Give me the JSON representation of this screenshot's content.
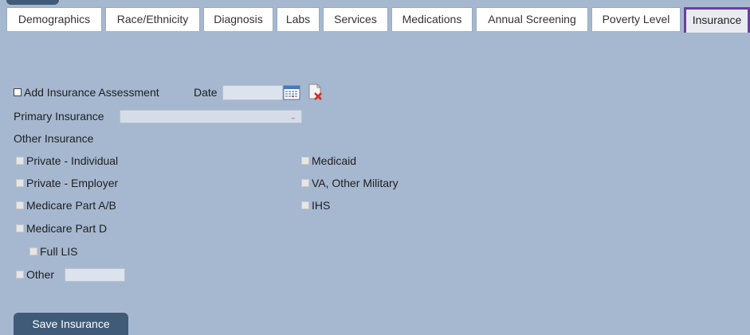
{
  "tabs": [
    {
      "label": "Demographics",
      "active": false
    },
    {
      "label": "Race/Ethnicity",
      "active": false
    },
    {
      "label": "Diagnosis",
      "active": false
    },
    {
      "label": "Labs",
      "active": false
    },
    {
      "label": "Services",
      "active": false
    },
    {
      "label": "Medications",
      "active": false
    },
    {
      "label": "Annual Screening",
      "active": false
    },
    {
      "label": "Poverty Level",
      "active": false
    },
    {
      "label": "Insurance",
      "active": true
    }
  ],
  "form": {
    "add_assessment_label": "Add Insurance Assessment",
    "add_assessment_checked": false,
    "date_label": "Date",
    "date_value": "",
    "primary_insurance_label": "Primary Insurance",
    "primary_insurance_value": "",
    "other_insurance_label": "Other Insurance",
    "options_left": [
      {
        "label": "Private - Individual",
        "checked": false
      },
      {
        "label": "Private - Employer",
        "checked": false
      },
      {
        "label": "Medicare Part A/B",
        "checked": false
      },
      {
        "label": "Medicare Part D",
        "checked": false
      }
    ],
    "full_lis_label": "Full LIS",
    "other_label": "Other",
    "other_value": "",
    "options_right": [
      {
        "label": "Medicaid",
        "checked": false
      },
      {
        "label": "VA, Other Military",
        "checked": false
      },
      {
        "label": "IHS",
        "checked": false
      }
    ],
    "save_label": "Save Insurance"
  },
  "colors": {
    "background": "#a6b8d0",
    "button": "#3f5b78",
    "active_tab_border": "#6b3fa0"
  },
  "icons": {
    "calendar": "calendar-icon",
    "clear_date": "clear-date-icon"
  }
}
